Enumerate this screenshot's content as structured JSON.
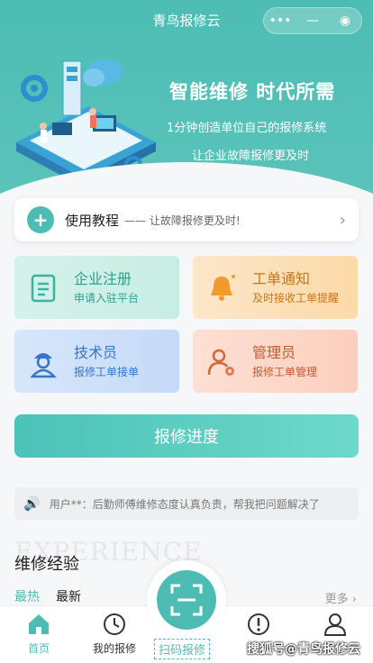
{
  "app": {
    "title": "青鸟报修云"
  },
  "capsule": {
    "more": "•••",
    "minimize": "—",
    "close": "◉"
  },
  "hero": {
    "slogan_main": "智能维修 时代所需",
    "slogan_line1": "1分钟创造单位自己的报修系统",
    "slogan_line2": "让企业故障报修更及时"
  },
  "tutorial": {
    "plus": "+",
    "title": "使用教程",
    "subtitle": "—— 让故障报修更及时!",
    "chevron": "›"
  },
  "cards": [
    {
      "title": "企业注册",
      "subtitle": "申请入驻平台",
      "icon": "clipboard-icon"
    },
    {
      "title": "工单通知",
      "subtitle": "及时接收工单提醒",
      "icon": "bell-icon"
    },
    {
      "title": "技术员",
      "subtitle": "报修工单接单",
      "icon": "worker-icon"
    },
    {
      "title": "管理员",
      "subtitle": "报修工单管理",
      "icon": "admin-icon"
    }
  ],
  "progress_button": "报修进度",
  "notice": {
    "text": "用户**：后勤师傅维修态度认真负责，帮我把问题解决了"
  },
  "experience": {
    "watermark": "EXPERIENCE",
    "title": "维修经验",
    "tab_hot": "最热",
    "tab_new": "最新",
    "more": "更多 ›"
  },
  "nav": {
    "home": "首页",
    "my_repairs": "我的报修",
    "scan": "扫码报修",
    "report": "",
    "profile": ""
  },
  "footer_note": "搜狐号@青鸟报修云",
  "colors": {
    "accent": "#4dbdb4",
    "orange": "#f0a33a"
  }
}
